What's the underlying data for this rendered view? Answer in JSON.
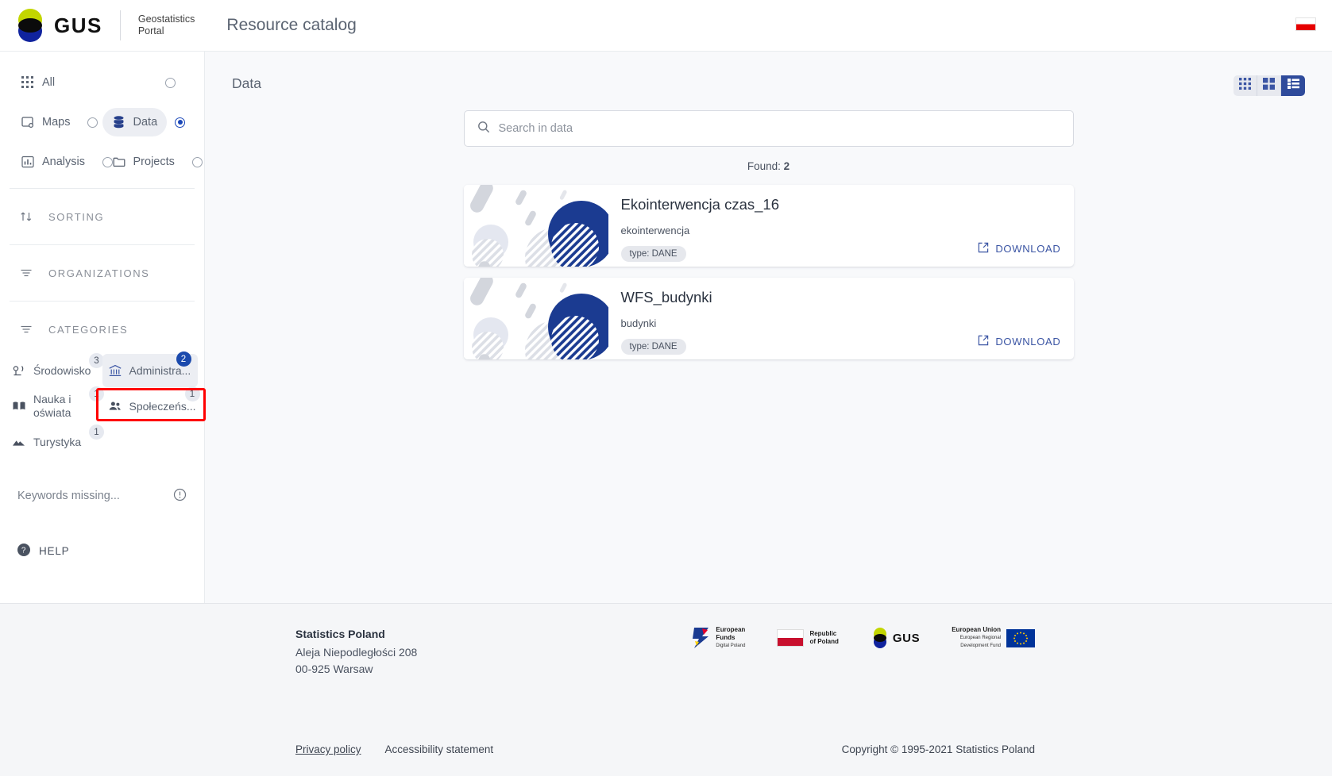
{
  "header": {
    "logo_text": "GUS",
    "portal_line1": "Geostatistics",
    "portal_line2": "Portal",
    "page_title": "Resource catalog",
    "lang_flag_icon": "poland-flag-icon"
  },
  "sidebar": {
    "nav": [
      {
        "label": "All",
        "icon": "grid-icon",
        "selected": false
      },
      {
        "label": "Maps",
        "icon": "map-icon",
        "selected": false
      },
      {
        "label": "Data",
        "icon": "database-icon",
        "selected": true
      },
      {
        "label": "Analysis",
        "icon": "chart-icon",
        "selected": false
      },
      {
        "label": "Projects",
        "icon": "folder-icon",
        "selected": false
      }
    ],
    "sections": [
      {
        "label": "SORTING",
        "icon": "sort-icon"
      },
      {
        "label": "ORGANIZATIONS",
        "icon": "filter-icon"
      },
      {
        "label": "CATEGORIES",
        "icon": "filter-icon"
      }
    ],
    "categories": [
      {
        "label": "Środowisko",
        "count": "3",
        "icon": "environment-icon",
        "highlighted": false
      },
      {
        "label": "Administra...",
        "count": "2",
        "icon": "government-icon",
        "highlighted": true
      },
      {
        "label": "Nauka i oświata",
        "count": "1",
        "icon": "book-icon",
        "highlighted": false
      },
      {
        "label": "Społeczeńs...",
        "count": "1",
        "icon": "people-icon",
        "highlighted": false
      },
      {
        "label": "Turystyka",
        "count": "1",
        "icon": "mountain-icon",
        "highlighted": false
      }
    ],
    "keywords_row": {
      "label": "Keywords missing...",
      "icon": "info-circle-icon"
    },
    "help": {
      "label": "HELP",
      "icon": "help-circle-icon"
    }
  },
  "main": {
    "title": "Data",
    "view_toggle": [
      {
        "name": "small-grid",
        "icon": "grid-3x3-icon",
        "active": false
      },
      {
        "name": "large-grid",
        "icon": "grid-2x2-icon",
        "active": false
      },
      {
        "name": "list",
        "icon": "list-icon",
        "active": true
      }
    ],
    "search": {
      "value": "",
      "placeholder": "Search in data",
      "icon": "search-icon"
    },
    "found_label": "Found:",
    "found_count": "2",
    "cards": [
      {
        "title": "Ekointerwencja czas_16",
        "subtitle": "ekointerwencja",
        "chip": "type: DANE",
        "download_label": "DOWNLOAD",
        "download_icon": "external-link-icon"
      },
      {
        "title": "WFS_budynki",
        "subtitle": "budynki",
        "chip": "type: DANE",
        "download_label": "DOWNLOAD",
        "download_icon": "external-link-icon"
      }
    ]
  },
  "footer": {
    "org": "Statistics Poland",
    "street": "Aleja Niepodległości 208",
    "city": "00-925 Warsaw",
    "logos": [
      {
        "name": "european-funds-logo",
        "line1": "European",
        "line2": "Funds",
        "line3": "Digital Poland"
      },
      {
        "name": "republic-poland-logo",
        "line1": "Republic",
        "line2": "of Poland",
        "line3": ""
      },
      {
        "name": "gus-logo",
        "line1": "GUS",
        "line2": "",
        "line3": ""
      },
      {
        "name": "european-union-logo",
        "line1": "European Union",
        "line2": "European Regional",
        "line3": "Development Fund"
      }
    ],
    "links": [
      {
        "label": "Privacy policy",
        "underline": true
      },
      {
        "label": "Accessibility statement",
        "underline": false
      }
    ],
    "copyright": "Copyright © 1995-2021 Statistics Poland"
  },
  "colors": {
    "accent_blue": "#2f4b9b",
    "badge_active": "#1b4aad",
    "link_blue": "#3b55a4",
    "highlight_red": "#ff0000",
    "logo_green": "#c3d600",
    "logo_blue": "#10239e"
  }
}
